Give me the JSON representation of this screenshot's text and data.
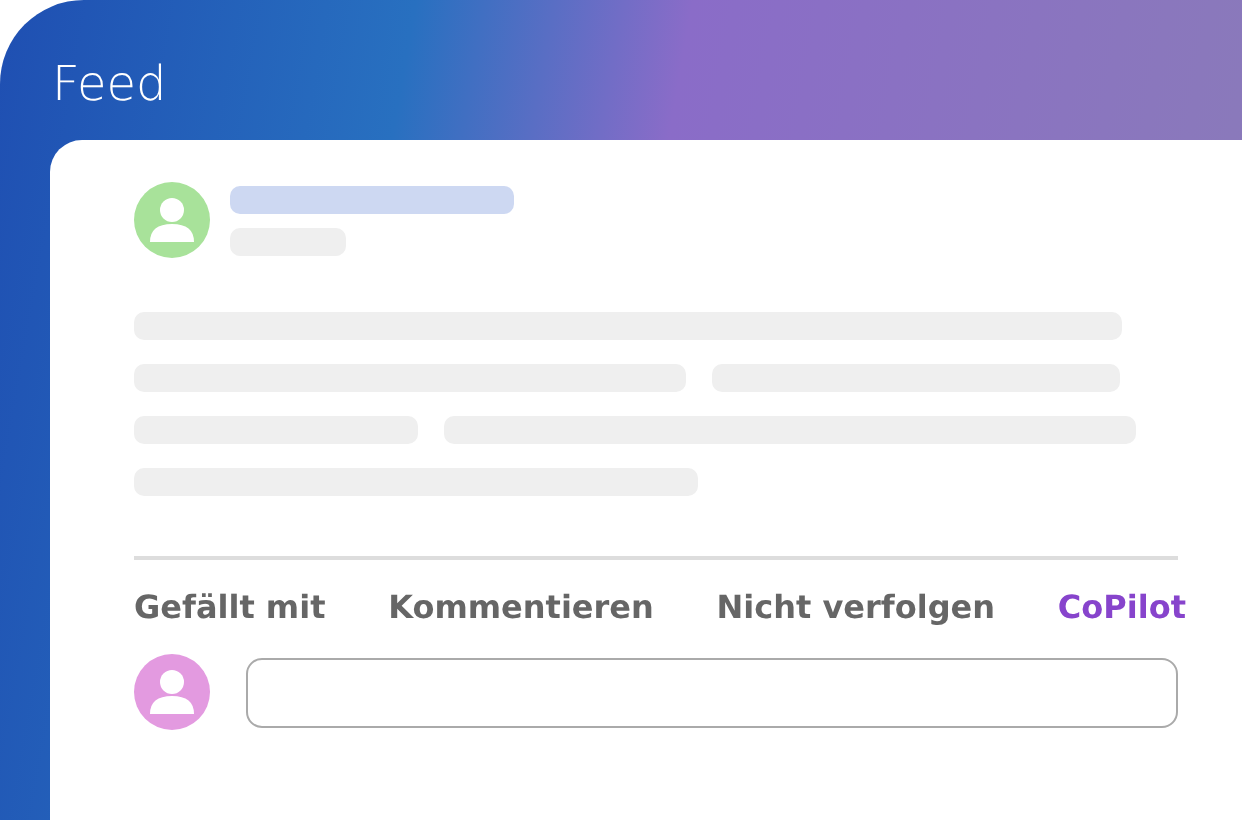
{
  "title": "Feed",
  "actions": [
    {
      "label": "Gefällt mit",
      "highlighted": false
    },
    {
      "label": "Kommentieren",
      "highlighted": false
    },
    {
      "label": "Nicht verfolgen",
      "highlighted": false
    },
    {
      "label": "CoPilot",
      "highlighted": true
    }
  ],
  "comment_field": {
    "kind": "empty"
  }
}
